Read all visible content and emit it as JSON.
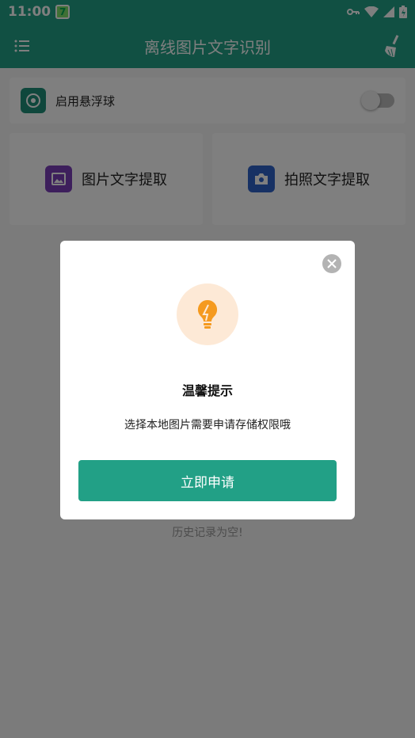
{
  "status_bar": {
    "time": "11:00",
    "app_badge": "7"
  },
  "app_bar": {
    "title": "离线图片文字识别"
  },
  "floating_ball": {
    "label": "启用悬浮球",
    "enabled": false
  },
  "tiles": [
    {
      "label": "图片文字提取",
      "color": "#7b3fb8"
    },
    {
      "label": "拍照文字提取",
      "color": "#2f63c8"
    }
  ],
  "history": {
    "empty_text": "历史记录为空!"
  },
  "dialog": {
    "title": "温馨提示",
    "message": "选择本地图片需要申请存储权限哦",
    "button_label": "立即申请",
    "bulb_color": "#f59a1f"
  },
  "colors": {
    "primary": "#22a086"
  }
}
